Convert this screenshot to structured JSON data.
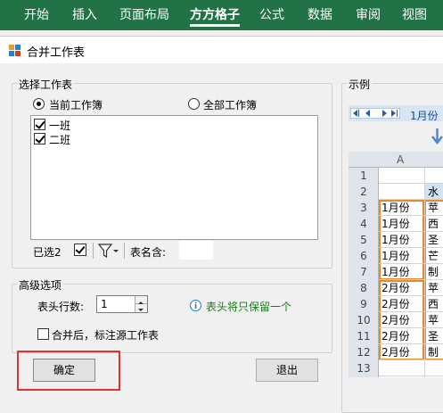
{
  "ribbon": {
    "tabs": [
      {
        "label": "开始"
      },
      {
        "label": "插入"
      },
      {
        "label": "页面布局"
      },
      {
        "label": "方方格子",
        "active": true
      },
      {
        "label": "公式"
      },
      {
        "label": "数据"
      },
      {
        "label": "审阅"
      },
      {
        "label": "视图"
      }
    ]
  },
  "dialog": {
    "title": "合并工作表",
    "select_group": {
      "legend": "选择工作表",
      "radio_current": "当前工作簿",
      "radio_all": "全部工作簿",
      "selected_radio": "current",
      "sheets": [
        {
          "name": "一班",
          "checked": true
        },
        {
          "name": "二班",
          "checked": true
        }
      ],
      "selected_count_label": "已选2",
      "sheet_name_label": "表名含:",
      "sheet_name_value": ""
    },
    "advanced_group": {
      "legend": "高级选项",
      "header_rows_label": "表头行数:",
      "header_rows_value": "1",
      "info_text": "表头将只保留一个",
      "mark_source_label": "合并后，标注源工作表",
      "mark_source_checked": false
    },
    "ok_label": "确定",
    "exit_label": "退出",
    "example": {
      "legend": "示例",
      "tab_label": "1月份",
      "column_header": "A",
      "row_numbers": [
        "1",
        "2",
        "3",
        "4",
        "5",
        "6",
        "7",
        "8",
        "9",
        "10",
        "11",
        "12",
        "13"
      ],
      "col_a": [
        "",
        "",
        "1月份",
        "1月份",
        "1月份",
        "1月份",
        "1月份",
        "2月份",
        "2月份",
        "2月份",
        "2月份",
        "2月份",
        ""
      ],
      "col_b": [
        "",
        "水",
        "苹",
        "西",
        "圣",
        "芒",
        "制",
        "苹",
        "西",
        "苹",
        "圣",
        "制",
        ""
      ]
    }
  },
  "colors": {
    "ribbon_bg": "#217346",
    "highlight": "#e03030",
    "orange_box": "#e8892c",
    "info_icon": "#1e78c8",
    "info_text": "#1a7a1a"
  }
}
